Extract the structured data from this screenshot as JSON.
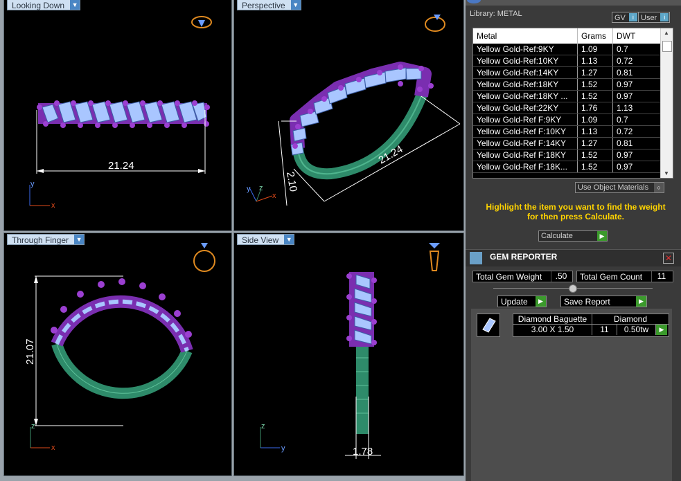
{
  "viewports": {
    "looking_down": {
      "label": "Looking Down",
      "dimension": "21.24",
      "axis_y": "y",
      "axis_x": "x"
    },
    "perspective": {
      "label": "Perspective",
      "dimension_long": "21.24",
      "dimension_short": "2.10",
      "axis_y": "y",
      "axis_z": "z",
      "axis_x": "x"
    },
    "through_finger": {
      "label": "Through Finger",
      "dimension": "21.07",
      "axis_z": "z",
      "axis_x": "x"
    },
    "side_view": {
      "label": "Side View",
      "dimension": "1.78",
      "axis_z": "z",
      "axis_y": "y"
    }
  },
  "library": {
    "title": "Library: METAL",
    "gv_label": "GV",
    "user_label": "User",
    "columns": [
      "Metal",
      "Grams",
      "DWT"
    ],
    "rows": [
      [
        "Yellow Gold-Ref:9KY",
        "1.09",
        "0.7"
      ],
      [
        "Yellow Gold-Ref:10KY",
        "1.13",
        "0.72"
      ],
      [
        "Yellow Gold-Ref:14KY",
        "1.27",
        "0.81"
      ],
      [
        "Yellow Gold-Ref:18KY",
        "1.52",
        "0.97"
      ],
      [
        "Yellow Gold-Ref:18KY ...",
        "1.52",
        "0.97"
      ],
      [
        "Yellow Gold-Ref:22KY",
        "1.76",
        "1.13"
      ],
      [
        "Yellow Gold-Ref F:9KY",
        "1.09",
        "0.7"
      ],
      [
        "Yellow Gold-Ref F:10KY",
        "1.13",
        "0.72"
      ],
      [
        "Yellow Gold-Ref F:14KY",
        "1.27",
        "0.81"
      ],
      [
        "Yellow Gold-Ref F:18KY",
        "1.52",
        "0.97"
      ],
      [
        "Yellow Gold-Ref F:18K...",
        "1.52",
        "0.97"
      ]
    ],
    "use_object_materials": "Use Object Materials",
    "hint_line1": "Highlight the item you want to find the weight",
    "hint_line2": "for then press Calculate.",
    "calculate": "Calculate"
  },
  "gem_reporter": {
    "title": "GEM REPORTER",
    "total_gem_weight_label": "Total Gem Weight",
    "total_gem_weight": ".50",
    "total_gem_count_label": "Total Gem Count",
    "total_gem_count": "11",
    "update": "Update",
    "save_report": "Save Report",
    "gem": {
      "shape": "Diamond Baguette",
      "material": "Diamond",
      "size": "3.00 X 1.50",
      "count": "11",
      "weight": "0.50tw"
    }
  },
  "colors": {
    "metal": "#9b3fd1",
    "gem": "#a9c6ff",
    "shank": "#2e8b6a",
    "viewport_bg": "#000000",
    "panel_bg": "#3a3a3a",
    "hint": "#ffd400"
  }
}
